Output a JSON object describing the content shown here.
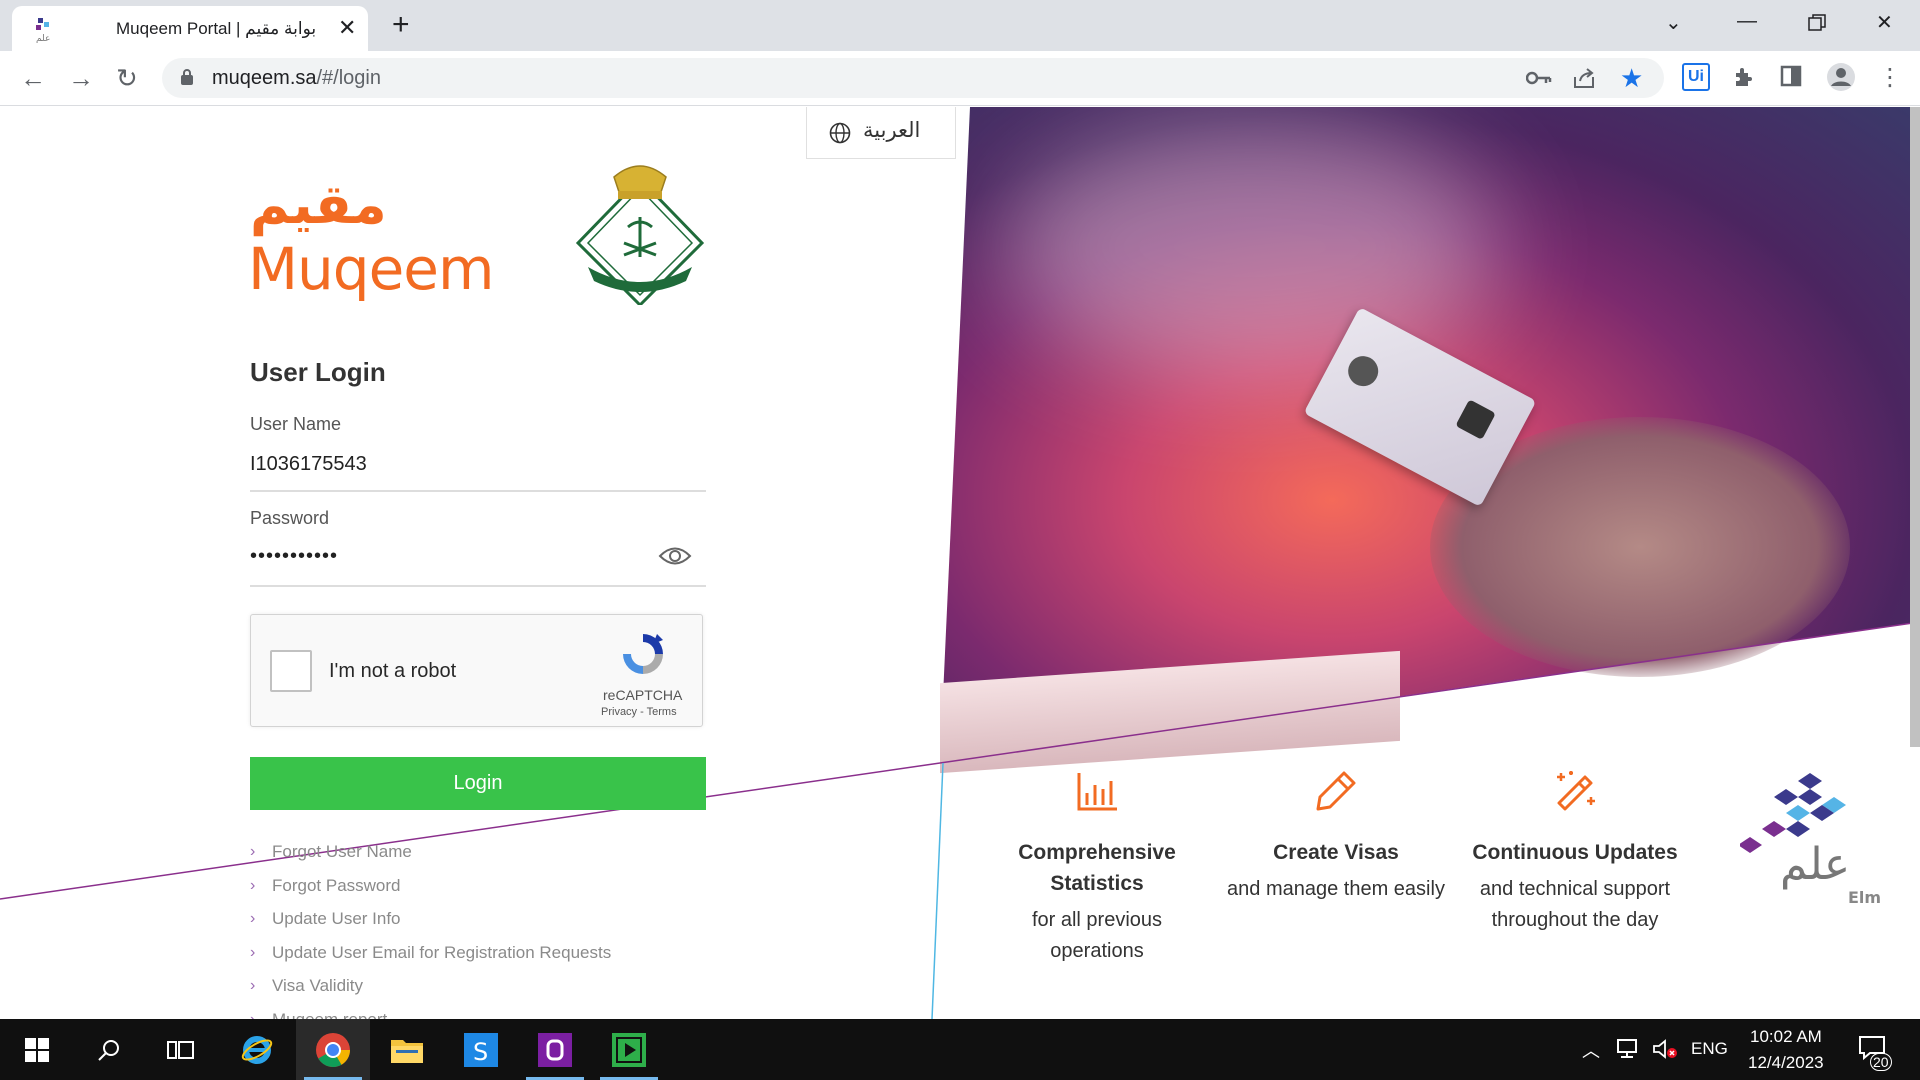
{
  "browser": {
    "tab_title": "Muqeem Portal | بوابة مقيم",
    "url_host": "muqeem.sa",
    "url_path": "/#/login",
    "ext_ui_label": "Ui"
  },
  "page": {
    "lang_switch": "العربية",
    "logo_ar": "مقيم",
    "logo_en": "Muqeem",
    "login": {
      "title": "User Login",
      "username_label": "User Name",
      "username_value": "I1036175543",
      "password_label": "Password",
      "password_value": "•••••••••••",
      "button_label": "Login"
    },
    "recaptcha": {
      "label": "I'm not a robot",
      "brand": "reCAPTCHA",
      "links": "Privacy - Terms"
    },
    "links": [
      "Forgot User Name",
      "Forgot Password",
      "Update User Info",
      "Update User Email for Registration Requests",
      "Visa Validity",
      "Muqeem report"
    ],
    "features": [
      {
        "title": "Comprehensive Statistics",
        "desc": "for all previous operations",
        "icon": "bar-chart-icon"
      },
      {
        "title": "Create Visas",
        "desc": "and manage them easily",
        "icon": "pencil-icon"
      },
      {
        "title": "Continuous Updates",
        "desc": "and technical support throughout the day",
        "icon": "magic-wand-icon"
      }
    ],
    "elm_logo_ar": "علم",
    "elm_logo_en": "Elm"
  },
  "taskbar": {
    "language": "ENG",
    "time": "10:02 AM",
    "date": "12/4/2023",
    "notifications": "20"
  },
  "colors": {
    "brand_orange": "#f26b22",
    "login_green": "#39c34a",
    "accent_purple": "#9b6bb2"
  }
}
